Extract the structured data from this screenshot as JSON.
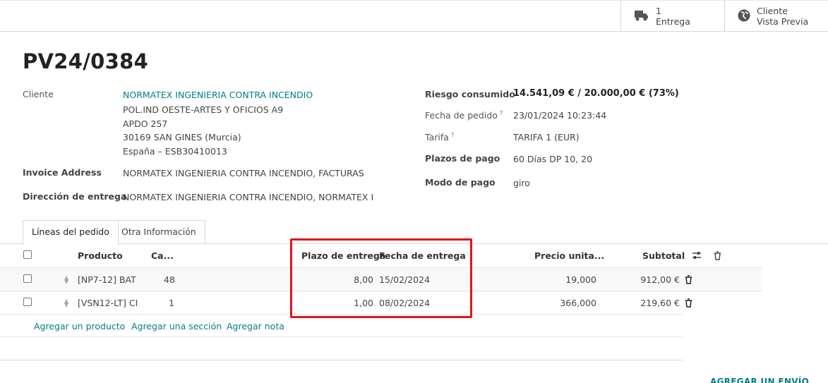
{
  "smart_buttons": {
    "delivery": {
      "count": "1",
      "label": "Entrega"
    },
    "preview": {
      "line1": "Cliente",
      "line2": "Vista Previa"
    }
  },
  "order": {
    "name": "PV24/0384"
  },
  "left_fields": {
    "customer_label": "Cliente",
    "customer_name": "NORMATEX INGENIERIA CONTRA INCENDIO",
    "address_line1": "POL.IND OESTE-ARTES Y OFICIOS A9",
    "address_line2": "APDO 257",
    "address_line3": "30169 SAN GINES (Murcia)",
    "address_line4": "España – ESB30410013",
    "invoice_label": "Invoice Address",
    "invoice_value": "NORMATEX INGENIERIA CONTRA INCENDIO, FACTURAS",
    "delivery_label": "Dirección de entrega",
    "delivery_value": "NORMATEX INGENIERIA CONTRA INCENDIO, NORMATEX IN("
  },
  "right_fields": {
    "risk_label": "Riesgo consumido",
    "risk_value": "14.541,09 € / 20.000,00 € (73%)",
    "order_date_label": "Fecha de pedido",
    "order_date_value": "23/01/2024 10:23:44",
    "pricelist_label": "Tarifa",
    "pricelist_value": "TARIFA 1 (EUR)",
    "payment_terms_label": "Plazos de pago",
    "payment_terms_value": "60 Días DP 10, 20",
    "payment_mode_label": "Modo de pago",
    "payment_mode_value": "giro",
    "help_mark": "?"
  },
  "tabs": {
    "lines": "Líneas del pedido",
    "other": "Otra Información"
  },
  "columns": {
    "product": "Producto",
    "qty": "Ca...",
    "lead_time": "Plazo de entrega",
    "delivery_date": "Fecha de entrega",
    "unit_price": "Precio unita...",
    "subtotal": "Subtotal"
  },
  "lines": [
    {
      "product": "[NP7-12] BAT",
      "qty": "48",
      "lead_time": "8,00",
      "delivery_date": "15/02/2024",
      "unit_price": "19,000",
      "subtotal": "912,00 €"
    },
    {
      "product": "[VSN12-LT] CI",
      "qty": "1",
      "lead_time": "1,00",
      "delivery_date": "08/02/2024",
      "unit_price": "366,000",
      "subtotal": "219,60 €"
    }
  ],
  "add_links": {
    "product": "Agregar un producto",
    "section": "Agregar una sección",
    "note": "Agregar nota"
  },
  "shipping_button": "AGREGAR UN ENVÍO",
  "colors": {
    "link": "#017e84",
    "highlight": "#e0161b"
  }
}
